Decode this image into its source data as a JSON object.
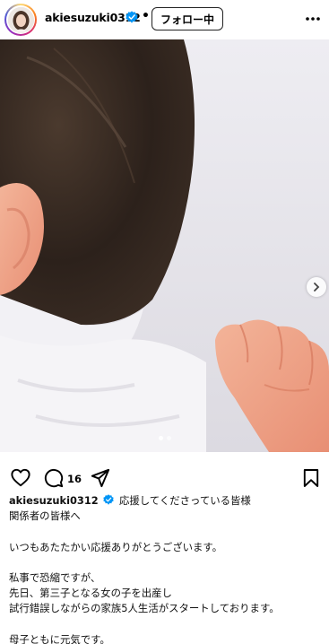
{
  "post": {
    "username": "akiesuzuki0312",
    "separator": "•",
    "follow_label": "フォロー中",
    "comment_count": "16",
    "photo_index": 1,
    "photo_total": 2
  },
  "caption": {
    "username": "akiesuzuki0312",
    "lines": [
      "応援してくださっている皆様",
      "関係者の皆様へ",
      "いつもあたたかい応援ありがとうございます。",
      "私事で恐縮ですが、",
      "先日、第三子となる女の子を出産し",
      "試行錯誤しながらの家族5人生活がスタートしております。",
      "母子ともに元気です。"
    ]
  },
  "icons": {
    "verified": "verified-badge-icon",
    "more": "more-options-icon",
    "like": "heart-icon",
    "comment": "comment-icon",
    "share": "share-icon",
    "save": "bookmark-icon",
    "next": "chevron-right-icon"
  },
  "colors": {
    "verified": "#0095f6",
    "text": "#000000"
  }
}
